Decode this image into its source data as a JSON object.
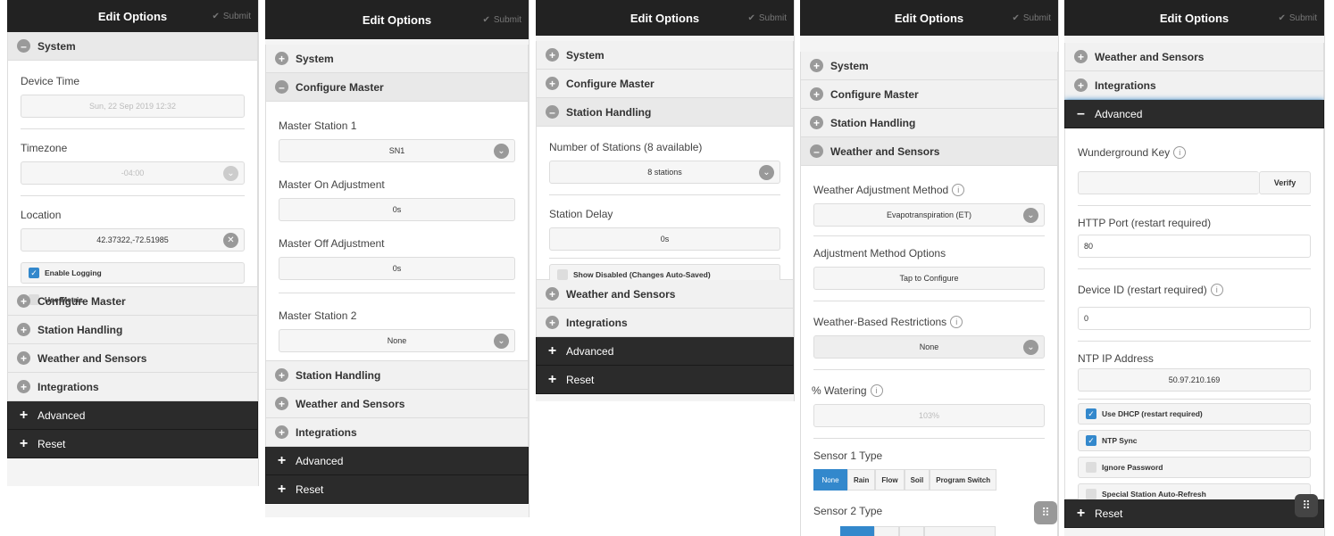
{
  "header": {
    "title": "Edit Options",
    "submit": "Submit",
    "submit_icon": "check-icon"
  },
  "sections": {
    "system": "System",
    "configure_master": "Configure Master",
    "station_handling": "Station Handling",
    "weather_sensors": "Weather and Sensors",
    "integrations": "Integrations",
    "advanced": "Advanced",
    "reset": "Reset"
  },
  "system": {
    "device_time_label": "Device Time",
    "device_time_value": "Sun, 22 Sep 2019 12:32",
    "timezone_label": "Timezone",
    "timezone_value": "-04:00",
    "location_label": "Location",
    "location_value": "42.37322,-72.51985",
    "enable_logging": "Enable Logging",
    "enable_logging_checked": true,
    "use_metric": "Use Metric",
    "use_metric_checked": false
  },
  "master": {
    "station1_label": "Master Station 1",
    "station1_value": "SN1",
    "on_adj_label": "Master On Adjustment",
    "on_adj_value": "0s",
    "off_adj_label": "Master Off Adjustment",
    "off_adj_value": "0s",
    "station2_label": "Master Station 2",
    "station2_value": "None"
  },
  "station_handling": {
    "num_stations_label": "Number of Stations (8 available)",
    "num_stations_value": "8 stations",
    "delay_label": "Station Delay",
    "delay_value": "0s",
    "show_disabled": "Show Disabled (Changes Auto-Saved)"
  },
  "weather": {
    "method_label": "Weather Adjustment Method",
    "method_value": "Evapotranspiration (ET)",
    "options_label": "Adjustment Method Options",
    "options_value": "Tap to Configure",
    "restrictions_label": "Weather-Based Restrictions",
    "restrictions_value": "None",
    "watering_label": "% Watering",
    "watering_value": "103%",
    "sensor1_label": "Sensor 1 Type",
    "sensor_types": [
      "None",
      "Rain",
      "Flow",
      "Soil",
      "Program Switch"
    ],
    "sensor1_selected": "None",
    "sensor2_label": "Sensor 2 Type"
  },
  "advanced": {
    "wunderground_label": "Wunderground Key",
    "wunderground_value": "",
    "verify": "Verify",
    "http_port_label": "HTTP Port (restart required)",
    "http_port_value": "80",
    "device_id_label": "Device ID (restart required)",
    "device_id_value": "0",
    "ntp_label": "NTP IP Address",
    "ntp_value": "50.97.210.169",
    "use_dhcp": "Use DHCP (restart required)",
    "use_dhcp_checked": true,
    "ntp_sync": "NTP Sync",
    "ntp_sync_checked": true,
    "ignore_password": "Ignore Password",
    "ignore_password_checked": false,
    "special_refresh": "Special Station Auto-Refresh",
    "special_refresh_checked": false
  },
  "colors": {
    "accent": "#3388cc",
    "header": "#222222",
    "dark_section": "#2b2b2b"
  }
}
